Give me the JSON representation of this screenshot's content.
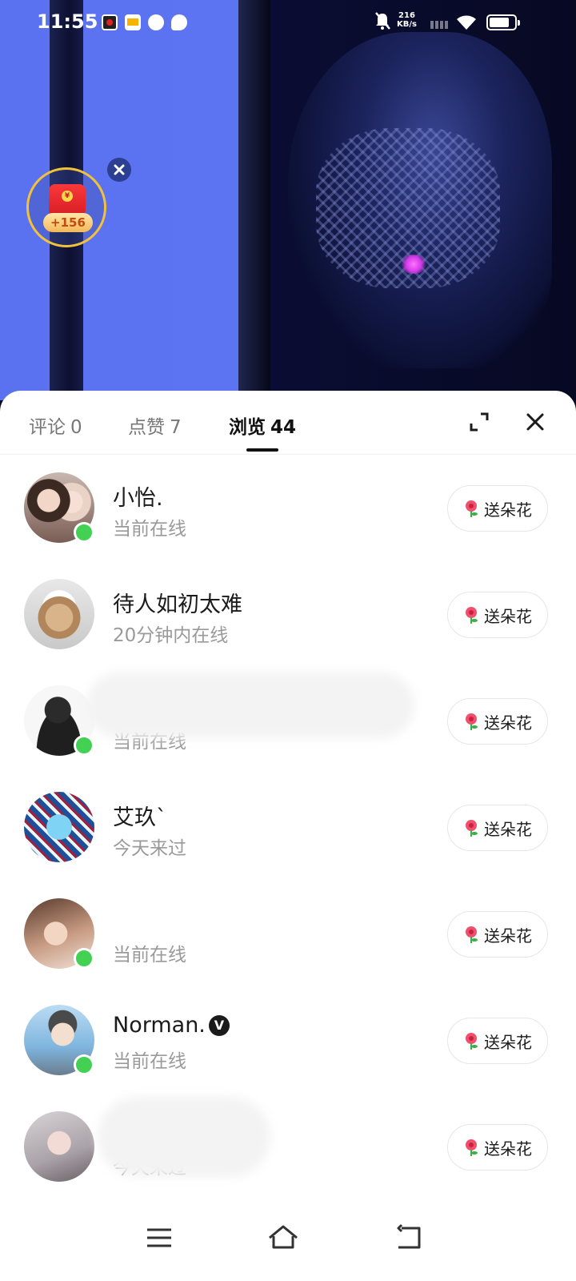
{
  "status_bar": {
    "time": "11:55",
    "net_speed_value": "216",
    "net_speed_unit": "KB/s"
  },
  "red_packet": {
    "amount": "+156",
    "coin_symbol": "¥"
  },
  "tabs": [
    {
      "label": "评论",
      "count": "0"
    },
    {
      "label": "点赞",
      "count": "7"
    },
    {
      "label": "浏览",
      "count": "44"
    }
  ],
  "visitors": [
    {
      "name": "小怡.",
      "status": "当前在线",
      "online": true
    },
    {
      "name": "待人如初太难",
      "status": "20分钟内在线",
      "online": false
    },
    {
      "name": "",
      "status": "当前在线",
      "online": true
    },
    {
      "name": "艾玖`",
      "status": "今天来过",
      "online": false
    },
    {
      "name": "",
      "status": "当前在线",
      "online": true
    },
    {
      "name": "Norman.",
      "status": "当前在线",
      "online": true,
      "verified_mark": "V"
    },
    {
      "name": "",
      "status": "今天来过",
      "online": false
    }
  ],
  "flower_button_label": "送朵花",
  "colors": {
    "online_dot": "#43d154",
    "red_packet": "#e0242a",
    "ring": "#f2c13b"
  }
}
